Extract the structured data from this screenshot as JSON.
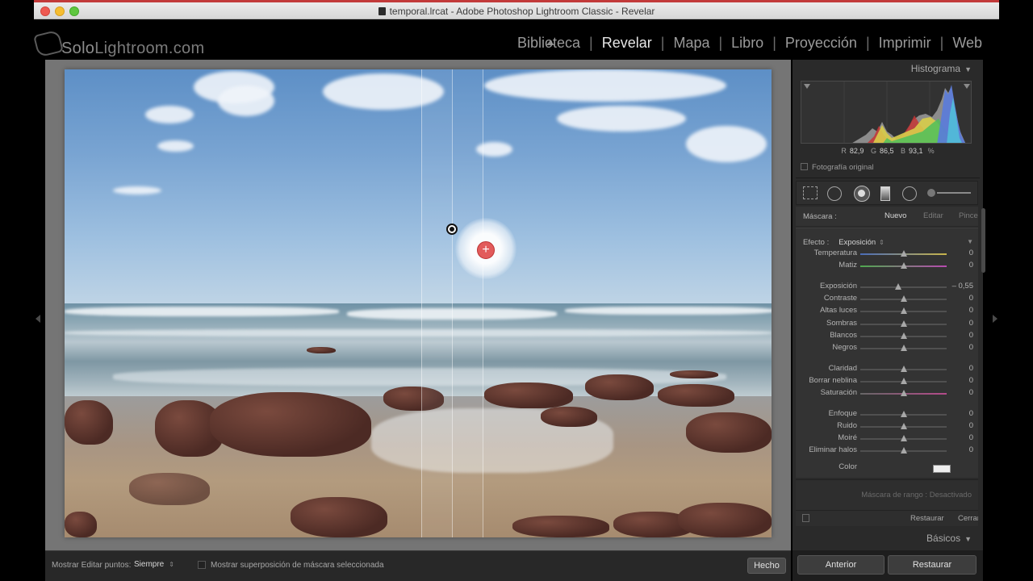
{
  "window": {
    "title": "temporal.lrcat - Adobe Photoshop Lightroom Classic - Revelar"
  },
  "logo": {
    "prefix": "Solo",
    "suffix": "Lightroom.com"
  },
  "modules": [
    {
      "label": "Biblioteca",
      "active": false
    },
    {
      "label": "Revelar",
      "active": true
    },
    {
      "label": "Mapa",
      "active": false
    },
    {
      "label": "Libro",
      "active": false
    },
    {
      "label": "Proyección",
      "active": false
    },
    {
      "label": "Imprimir",
      "active": false
    },
    {
      "label": "Web",
      "active": false
    }
  ],
  "toolbar": {
    "show_edit_points_label": "Mostrar Editar puntos:",
    "show_edit_points_value": "Siempre",
    "overlay_label": "Mostrar superposición de máscara seleccionada",
    "done_label": "Hecho"
  },
  "histogram": {
    "title": "Histograma",
    "r_label": "R",
    "r_value": "82,9",
    "g_label": "G",
    "g_value": "86,5",
    "b_label": "B",
    "b_value": "93,1",
    "unit": "%",
    "original_photo_label": "Fotografía original"
  },
  "mask": {
    "label": "Máscara :",
    "new_label": "Nuevo",
    "edit_label": "Editar",
    "brush_label": "Pincel"
  },
  "effect": {
    "label": "Efecto :",
    "value": "Exposición"
  },
  "sliders": [
    {
      "name": "Temperatura",
      "value": "0",
      "pos": 0.5
    },
    {
      "name": "Matiz",
      "value": "0",
      "pos": 0.5
    },
    {
      "name": "Exposición",
      "value": "– 0,55",
      "pos": 0.44
    },
    {
      "name": "Contraste",
      "value": "0",
      "pos": 0.5
    },
    {
      "name": "Altas luces",
      "value": "0",
      "pos": 0.5
    },
    {
      "name": "Sombras",
      "value": "0",
      "pos": 0.5
    },
    {
      "name": "Blancos",
      "value": "0",
      "pos": 0.5
    },
    {
      "name": "Negros",
      "value": "0",
      "pos": 0.5
    },
    {
      "name": "Claridad",
      "value": "0",
      "pos": 0.5
    },
    {
      "name": "Borrar neblina",
      "value": "0",
      "pos": 0.5
    },
    {
      "name": "Saturación",
      "value": "0",
      "pos": 0.5
    },
    {
      "name": "Enfoque",
      "value": "0",
      "pos": 0.5
    },
    {
      "name": "Ruido",
      "value": "0",
      "pos": 0.5
    },
    {
      "name": "Moiré",
      "value": "0",
      "pos": 0.5
    },
    {
      "name": "Eliminar halos",
      "value": "0",
      "pos": 0.5
    }
  ],
  "color_label": "Color",
  "range_mask": "Máscara de rango : Desactivado",
  "panel_buttons": {
    "reset": "Restaurar",
    "close": "Cerrar"
  },
  "basics_label": "Básicos",
  "bottom_buttons": {
    "previous": "Anterior",
    "reset": "Restaurar"
  },
  "colors": {
    "active_pin": "#e25b5b",
    "panel_bg": "#2a2a2a",
    "canvas_bg": "#757575"
  }
}
